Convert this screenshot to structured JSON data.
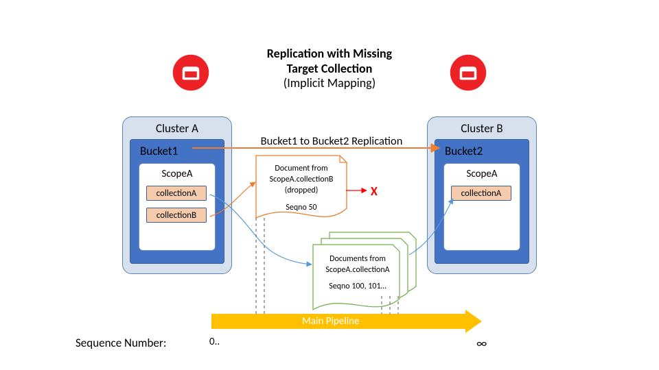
{
  "title_line1": "Replication with Missing",
  "title_line2": "Target Collection",
  "title_line3": "(Implicit Mapping)",
  "clusterA": {
    "label": "Cluster A",
    "bucket": "Bucket1",
    "scope": "ScopeA",
    "collections": [
      "collectionA",
      "collectionB"
    ]
  },
  "clusterB": {
    "label": "Cluster B",
    "bucket": "Bucket2",
    "scope": "ScopeA",
    "collections": [
      "collectionA"
    ]
  },
  "replication_label": "Bucket1 to Bucket2 Replication",
  "dropped_doc": {
    "line1": "Document from",
    "line2": "ScopeA.collectionB",
    "line3": "(dropped)",
    "seq": "Seqno 50",
    "marker": "X"
  },
  "flow_doc": {
    "line1": "Documents from",
    "line2": "ScopeA.collectionA",
    "seq": "Seqno 100, 101…"
  },
  "pipeline_label": "Main Pipeline",
  "sequence_label": "Sequence Number:",
  "axis_start": "0..",
  "axis_end": "∞",
  "colors": {
    "red": "#ED2226",
    "orange_arrow": "#ed7d31",
    "blue_arrow": "#5b9bd5",
    "green": "#70ad47",
    "amber": "#ffc000"
  },
  "chart_data": {
    "type": "diagram",
    "description": "XDCR replication diagram: Bucket1 (ScopeA with collectionA & collectionB) replicates to Bucket2 (ScopeA with collectionA). Documents from collectionB arrive with no target and are dropped at Seqno 50; documents from collectionA continue to Bucket2 at Seqno 100, 101…; both flow along a Main Pipeline from sequence 0 to ∞."
  }
}
